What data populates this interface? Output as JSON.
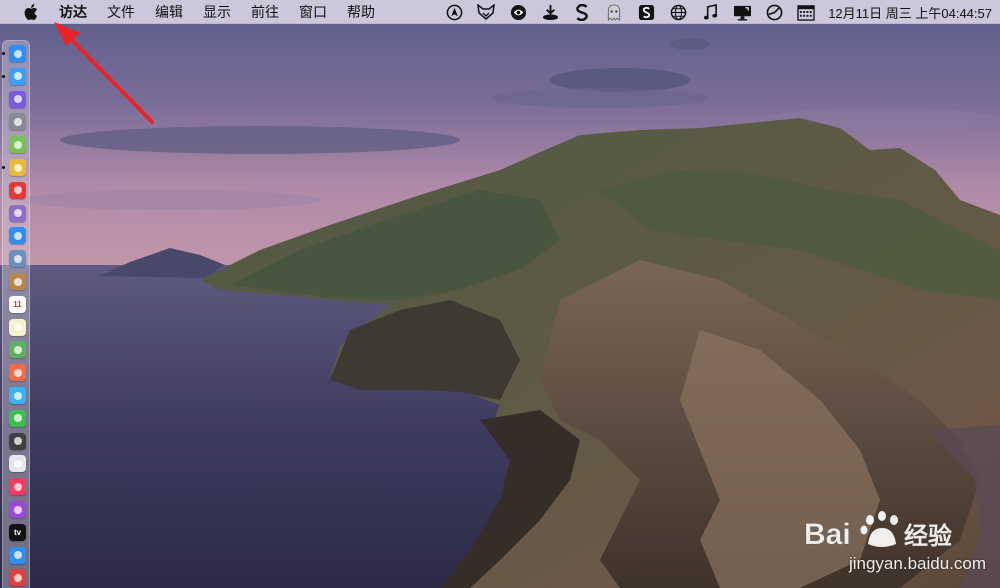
{
  "menubar": {
    "app_name": "访达",
    "items": [
      "文件",
      "编辑",
      "显示",
      "前往",
      "窗口",
      "帮助"
    ],
    "clock": "12月11日 周三 上午04:44:57",
    "tray_icons": [
      "navigation-icon",
      "fox-icon",
      "circle-logo-icon",
      "download-icon",
      "s-app-icon",
      "ghost-icon",
      "s-box-icon",
      "globe-icon",
      "music-note-icon",
      "display-icon",
      "dial-icon",
      "calendar-icon"
    ]
  },
  "dock": {
    "items": [
      {
        "name": "finder-icon",
        "color": "#2b8ff5",
        "running": true
      },
      {
        "name": "app-store-icon",
        "color": "#3aa0f5",
        "running": true
      },
      {
        "name": "siri-icon",
        "color": "#7a5ae0",
        "running": false
      },
      {
        "name": "launchpad-icon",
        "color": "#8a8a95",
        "running": false
      },
      {
        "name": "android-icon",
        "color": "#79c257",
        "running": false
      },
      {
        "name": "chrome-icon",
        "color": "#e8b93a",
        "running": true
      },
      {
        "name": "red-app-icon",
        "color": "#e53935",
        "running": false
      },
      {
        "name": "notes-app-icon",
        "color": "#8e6cc9",
        "running": false
      },
      {
        "name": "safari-icon",
        "color": "#2f8ef0",
        "running": false
      },
      {
        "name": "preview-icon",
        "color": "#6c8fbf",
        "running": false
      },
      {
        "name": "contacts-icon",
        "color": "#b8874e",
        "running": false
      },
      {
        "name": "calendar-app-icon",
        "color": "#ffffff",
        "running": false,
        "text": "11"
      },
      {
        "name": "stickies-icon",
        "color": "#f7f0c8",
        "running": false
      },
      {
        "name": "maps-icon",
        "color": "#5fb05f",
        "running": false
      },
      {
        "name": "photos-icon",
        "color": "#f06c46",
        "running": false
      },
      {
        "name": "messages-icon",
        "color": "#3ab0f5",
        "running": false
      },
      {
        "name": "facetime-icon",
        "color": "#3dbf4f",
        "running": false
      },
      {
        "name": "clock-icon",
        "color": "#404040",
        "running": false
      },
      {
        "name": "downloads-icon",
        "color": "#e6e6ee",
        "running": false
      },
      {
        "name": "music-icon",
        "color": "#f53c5c",
        "running": false
      },
      {
        "name": "podcasts-icon",
        "color": "#9a4ad8",
        "running": false
      },
      {
        "name": "apple-tv-icon",
        "color": "#111111",
        "running": false,
        "text": "tv"
      },
      {
        "name": "app-store-2-icon",
        "color": "#2f8ef0",
        "running": false
      },
      {
        "name": "vivaldi-icon",
        "color": "#e2403c",
        "running": false
      }
    ]
  },
  "watermark": {
    "text": "jingyan.baidu.com"
  }
}
